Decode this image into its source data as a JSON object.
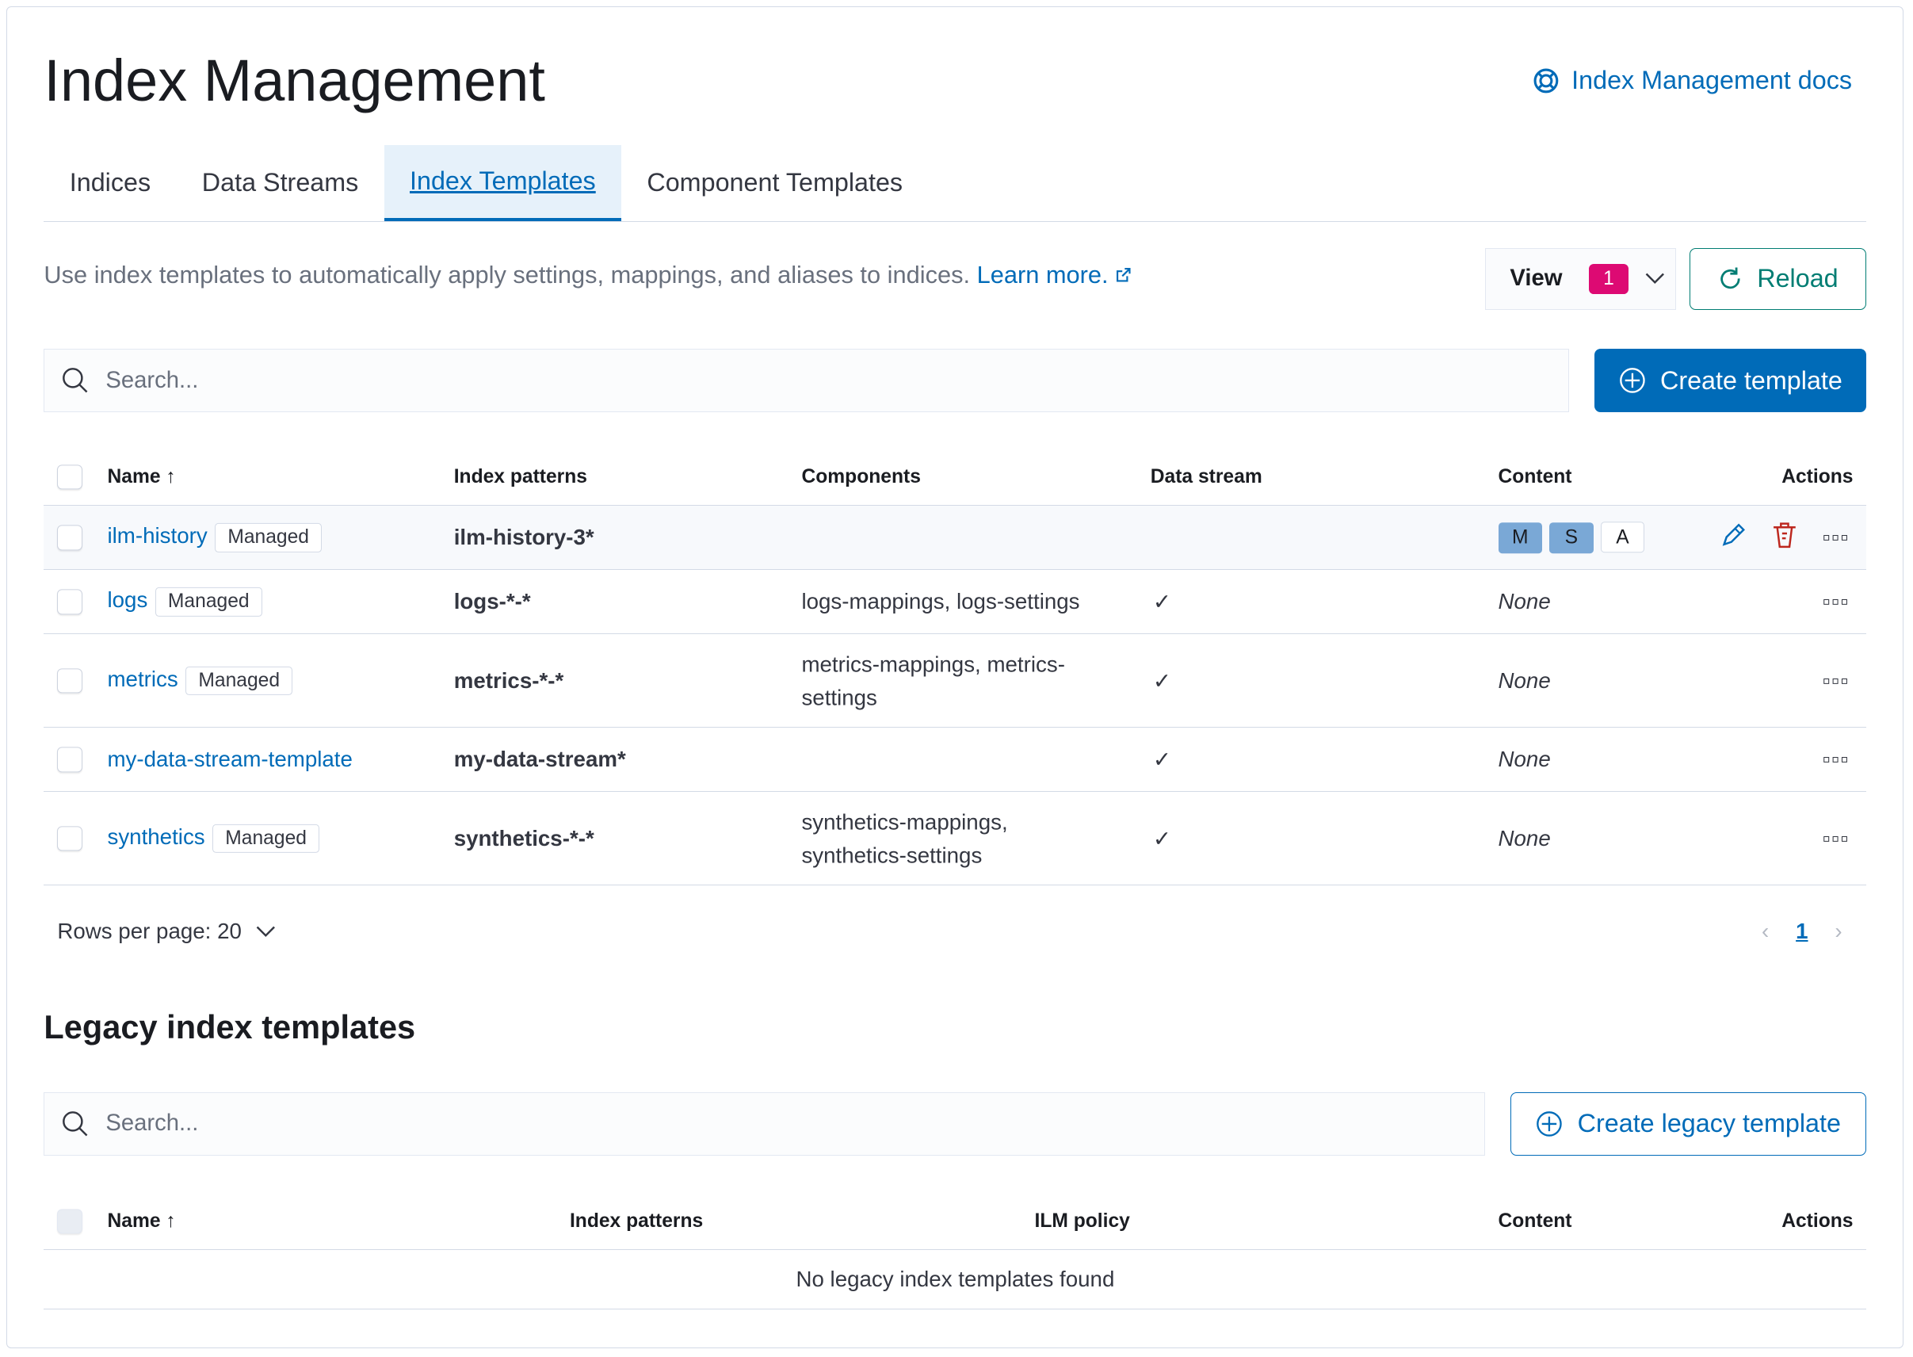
{
  "header": {
    "title": "Index Management",
    "docs_link": "Index Management docs"
  },
  "tabs": [
    {
      "label": "Indices"
    },
    {
      "label": "Data Streams"
    },
    {
      "label": "Index Templates"
    },
    {
      "label": "Component Templates"
    }
  ],
  "description": {
    "text": "Use index templates to automatically apply settings, mappings, and aliases to indices.",
    "learn_more": "Learn more."
  },
  "toolbar": {
    "view_label": "View",
    "view_count": "1",
    "reload_label": "Reload",
    "search_placeholder": "Search...",
    "create_label": "Create template"
  },
  "table": {
    "columns": [
      "Name",
      "Index patterns",
      "Components",
      "Data stream",
      "Content",
      "Actions"
    ],
    "rows": [
      {
        "name": "ilm-history",
        "badge": "Managed",
        "patterns": "ilm-history-3*",
        "components": "",
        "data_stream": false,
        "content": [
          "M",
          "S",
          "A"
        ]
      },
      {
        "name": "logs",
        "badge": "Managed",
        "patterns": "logs-*-*",
        "components": "logs-mappings, logs-settings",
        "data_stream": true,
        "content": "None"
      },
      {
        "name": "metrics",
        "badge": "Managed",
        "patterns": "metrics-*-*",
        "components": "metrics-mappings, metrics-settings",
        "data_stream": true,
        "content": "None"
      },
      {
        "name": "my-data-stream-template",
        "badge": "",
        "patterns": "my-data-stream*",
        "components": "",
        "data_stream": true,
        "content": "None"
      },
      {
        "name": "synthetics",
        "badge": "Managed",
        "patterns": "synthetics-*-*",
        "components": "synthetics-mappings, synthetics-settings",
        "data_stream": true,
        "content": "None"
      }
    ]
  },
  "pagination": {
    "rows_per_page": "Rows per page: 20",
    "current_page": "1"
  },
  "legacy": {
    "title": "Legacy index templates",
    "search_placeholder": "Search...",
    "create_label": "Create legacy template",
    "columns": [
      "Name",
      "Index patterns",
      "ILM policy",
      "Content",
      "Actions"
    ],
    "empty": "No legacy index templates found"
  },
  "colors": {
    "primary": "#006bb8",
    "success": "#017d73",
    "accent": "#dd0a73",
    "danger": "#bd271e"
  }
}
